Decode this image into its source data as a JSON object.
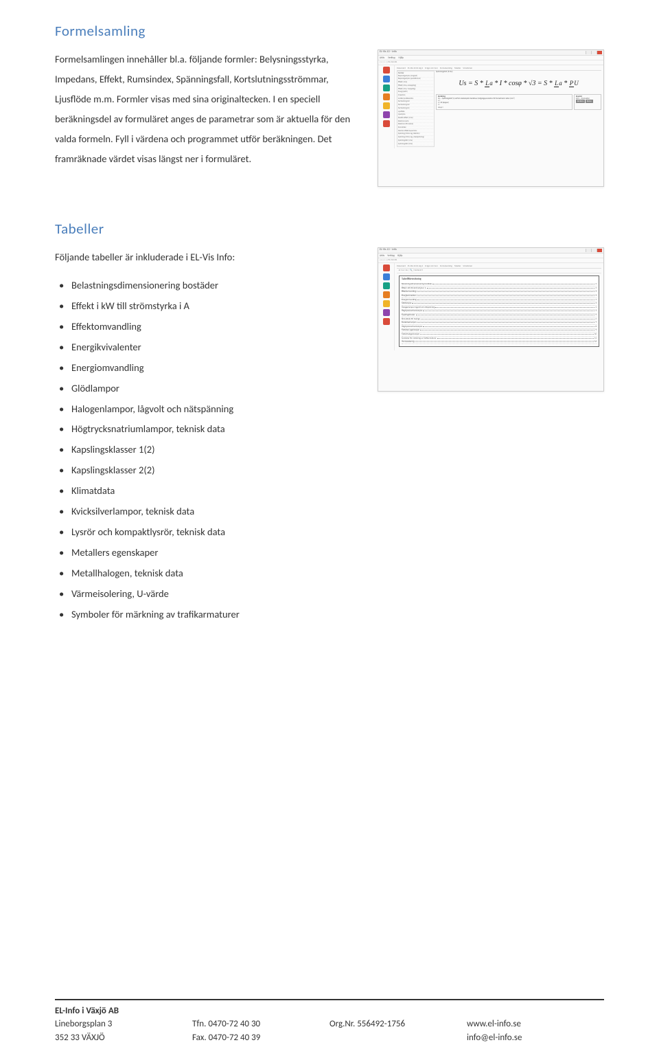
{
  "section1": {
    "heading": "Formelsamling",
    "para": "Formelsamlingen innehåller bl.a. följande formler: Belysningsstyrka, Impedans, Effekt, Rumsindex, Spänningsfall, Kortslutningsströmmar, Ljusflöde m.m. Formler visas med sina originaltecken. I en speciell beräkningsdel av formuläret anges de parametrar som är aktuella för den valda formeln. Fyll i värdena och programmet utför beräkningen. Det framräknade värdet visas längst ner i formuläret."
  },
  "thumb1": {
    "title": "EL-Vis 13 – Info",
    "menu": [
      "Arkiv",
      "Verktyg",
      "Hjälp"
    ],
    "tabs": [
      "Dokument",
      "SS 436 40 00 utg 2",
      "Frågor och Svar",
      "Formelsamling",
      "Tabeller",
      "Schabloner"
    ],
    "formula_label": "Spänningsfall (3-fas)",
    "formula_parts": {
      "Us": "Us",
      "S": "S",
      "L": "L",
      "a": "a",
      "I": "I",
      "cos": "cosφ",
      "root3": "√3",
      "P": "P",
      "U": "U"
    },
    "list_heading": "Formler",
    "list": [
      "Belysningsstyrka (omgivet)",
      "Belysningsstyrka (punktformat)",
      "Effekt (1-fas)",
      "Effekt (3-fas, el-koppling)",
      "Effekt (3-fas, Y-koppling)",
      "Energi (kWh)",
      "Impedans",
      "Inställd jordfelsström",
      "Kortslutning Ik3",
      "Kortslutning Ik2",
      "Kortslutning Ik1",
      "Ljusflöde",
      "Ljusstyrka",
      "Reaktiv effekt (1-fas)",
      "Resistans serie",
      "Resistans (för ledare)",
      "Rumsindex",
      "Skenbar effekt/kapacitans",
      "Spänning (Ohms lag, likström)",
      "Spänning (Ohms lag, växelspänning)",
      "Spänningsfall (1-fas)",
      "Spänningsfall (3-fas)"
    ],
    "calc_heading": "Beräkning",
    "calc_text": "Us — Spänningsfall (V) varifrån mellanspänn beräknas.\\nUtgångsparametrar för formell berä i sidan (mm²)",
    "calc_inputs": [
      "a =",
      "L = 35 (koppar)",
      "I =",
      "cos φ ="
    ],
    "calc_buttons": [
      "Beräkna",
      "Rensa"
    ],
    "result_heading": "Resultat",
    "result_text": "Fyll i … tryck sedan"
  },
  "section2": {
    "heading": "Tabeller",
    "intro": "Följande tabeller är inkluderade i EL-Vis Info:",
    "items": [
      "Belastningsdimensionering bostäder",
      "Effekt i kW till strömstyrka i A",
      "Effektomvandling",
      "Energikvivalenter",
      "Energiomvandling",
      "Glödlampor",
      "Halogenlampor, lågvolt och nätspänning",
      "Högtrycksnatriumlampor, teknisk data",
      "Kapslingsklasser 1(2)",
      "Kapslingsklasser 2(2)",
      "Klimatdata",
      "Kvicksilverlampor, teknisk data",
      "Lysrör och kompaktlysrör, teknisk data",
      "Metallers egenskaper",
      "Metallhalogen, teknisk data",
      "Värmeisolering, U-värde",
      "Symboler för märkning av trafikarmaturer"
    ]
  },
  "thumb2": {
    "title": "EL-Vis 13 – Info",
    "menu": [
      "Arkiv",
      "Verktyg",
      "Hjälp"
    ],
    "tabs": [
      "Dokument",
      "SS 436 40 00 utg 2",
      "Frågor och Svar",
      "Formelsamling",
      "Tabeller",
      "Schabloner"
    ],
    "box_title": "Tabellförteckning",
    "rows": [
      [
        "Belastningsdimensionering bostäder",
        "2"
      ],
      [
        "Effekt i kW till strömstyrka i A",
        "3"
      ],
      [
        "Effektomvandling",
        "3"
      ],
      [
        "Energikvivalenter",
        "3"
      ],
      [
        "Energiomvandling",
        "3"
      ],
      [
        "Glödlampor",
        "4"
      ],
      [
        "Halogenlampor lågvolt och nätspänning",
        "4"
      ],
      [
        "Högtrycksnatriumlampor",
        "4"
      ],
      [
        "Kapslingsklasser",
        "5"
      ],
      [
        "Klimatdata för Sverige",
        "6"
      ],
      [
        "Kvicksilverlampor",
        "7"
      ],
      [
        "Högtrycksnatriumlampor",
        "8"
      ],
      [
        "Metallers egenskaper",
        "9"
      ],
      [
        "Metallhalogenlampor",
        "10"
      ],
      [
        "Symboler för märkning av trafikarmaturer",
        "11"
      ],
      [
        "Värmeisolering",
        "12"
      ]
    ]
  },
  "footer": {
    "company": "EL-Info i Växjö AB",
    "addr1": "Lineborgsplan 3",
    "addr2": "352 33 VÄXJÖ",
    "tfn_label": "Tfn.",
    "tfn": "0470-72 40 30",
    "fax_label": "Fax.",
    "fax": "0470-72 40 39",
    "org_label": "Org.Nr.",
    "org": "556492-1756",
    "web": "www.el-info.se",
    "email": "info@el-info.se"
  }
}
